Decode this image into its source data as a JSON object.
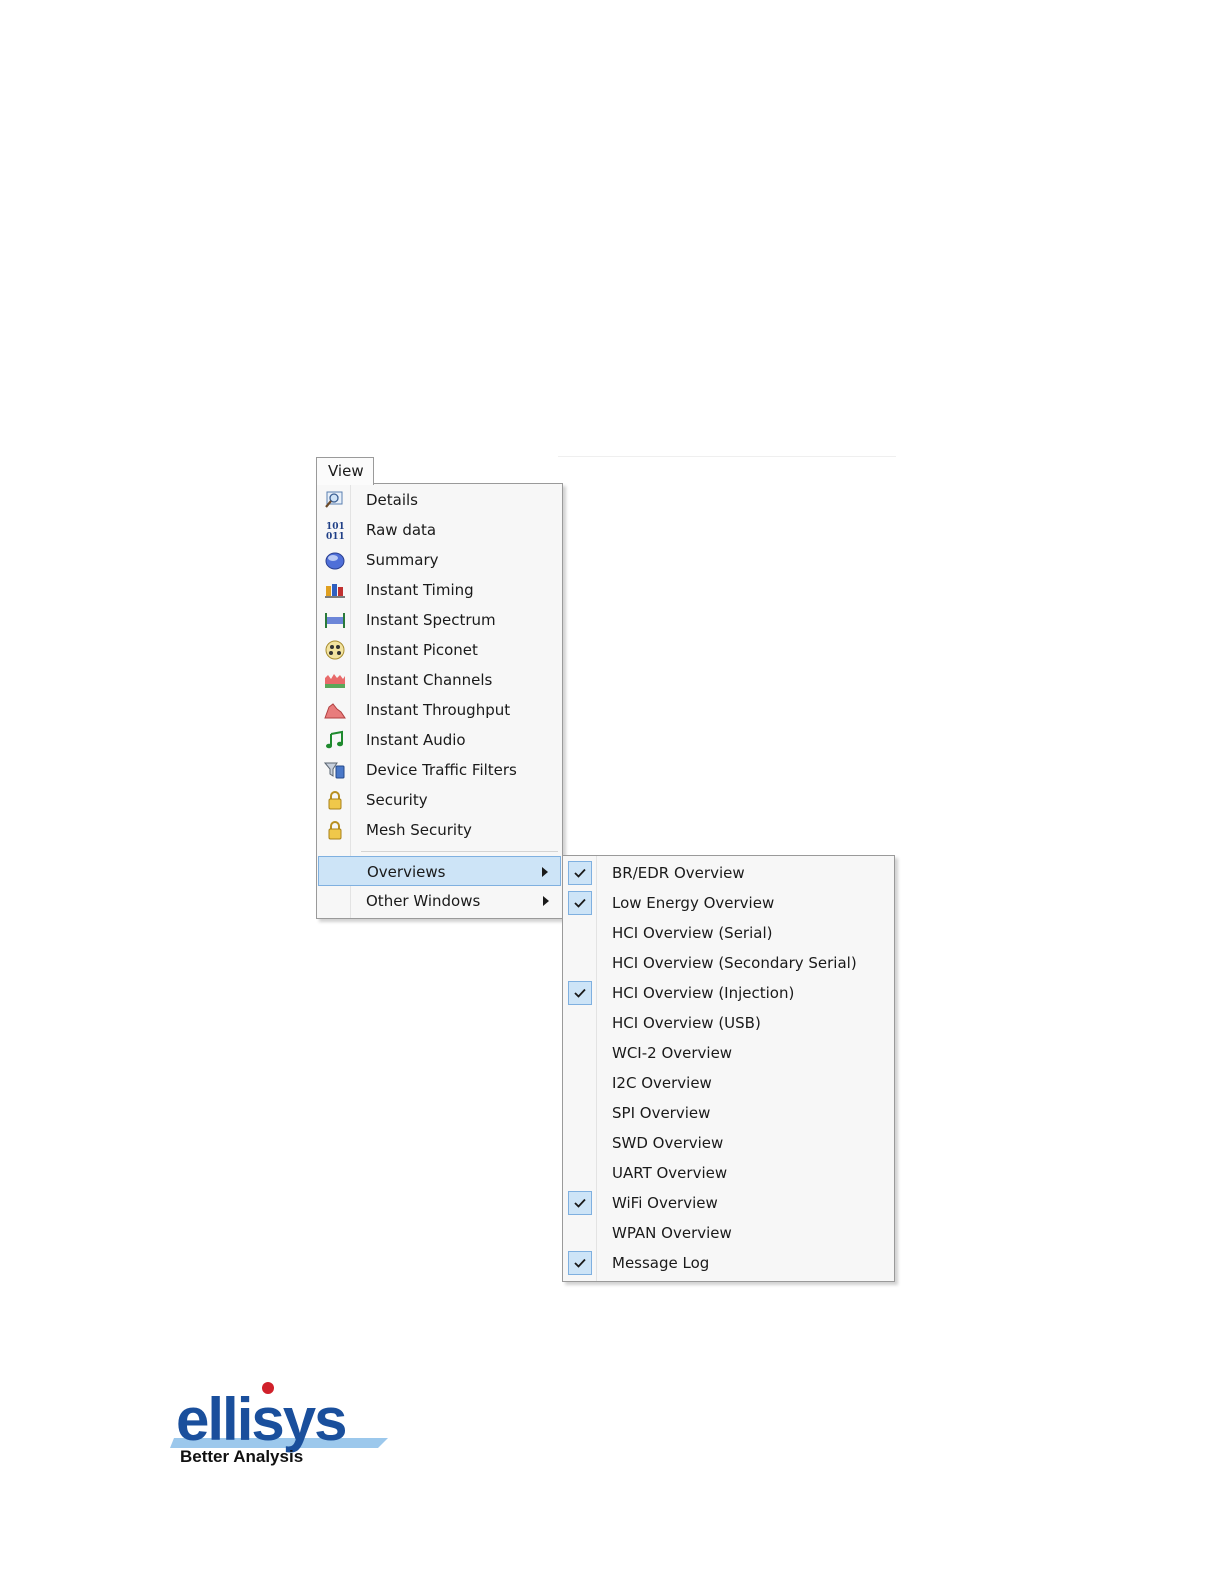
{
  "menu_tab": {
    "label": "View"
  },
  "main_menu": {
    "items": [
      {
        "label": "Details",
        "icon": "details-magnifier-icon"
      },
      {
        "label": "Raw data",
        "icon": "raw-data-binary-icon"
      },
      {
        "label": "Summary",
        "icon": "summary-disk-icon"
      },
      {
        "label": "Instant Timing",
        "icon": "instant-timing-icon"
      },
      {
        "label": "Instant Spectrum",
        "icon": "instant-spectrum-icon"
      },
      {
        "label": "Instant Piconet",
        "icon": "instant-piconet-icon"
      },
      {
        "label": "Instant Channels",
        "icon": "instant-channels-icon"
      },
      {
        "label": "Instant Throughput",
        "icon": "instant-throughput-icon"
      },
      {
        "label": "Instant Audio",
        "icon": "music-note-icon"
      },
      {
        "label": "Device Traffic Filters",
        "icon": "funnel-filter-icon"
      },
      {
        "label": "Security",
        "icon": "padlock-icon"
      },
      {
        "label": "Mesh Security",
        "icon": "padlock-icon"
      }
    ],
    "overviews_label": "Overviews",
    "other_windows_label": "Other Windows"
  },
  "overviews_submenu": {
    "items": [
      {
        "label": "BR/EDR Overview",
        "checked": true
      },
      {
        "label": "Low Energy Overview",
        "checked": true
      },
      {
        "label": "HCI Overview (Serial)",
        "checked": false
      },
      {
        "label": "HCI Overview (Secondary Serial)",
        "checked": false
      },
      {
        "label": "HCI Overview (Injection)",
        "checked": true
      },
      {
        "label": "HCI Overview (USB)",
        "checked": false
      },
      {
        "label": "WCI-2 Overview",
        "checked": false
      },
      {
        "label": "I2C Overview",
        "checked": false
      },
      {
        "label": "SPI Overview",
        "checked": false
      },
      {
        "label": "SWD Overview",
        "checked": false
      },
      {
        "label": "UART Overview",
        "checked": false
      },
      {
        "label": "WiFi Overview",
        "checked": true
      },
      {
        "label": "WPAN Overview",
        "checked": false
      },
      {
        "label": "Message Log",
        "checked": true
      }
    ]
  },
  "logo": {
    "wordmark": "ellisys",
    "tagline": "Better Analysis",
    "brand_color": "#1a4f9c",
    "dot_color": "#d0202a"
  },
  "colors": {
    "highlight": "#cde4f7",
    "highlight_border": "#7fb0e0",
    "menu_bg": "#f7f7f7"
  }
}
